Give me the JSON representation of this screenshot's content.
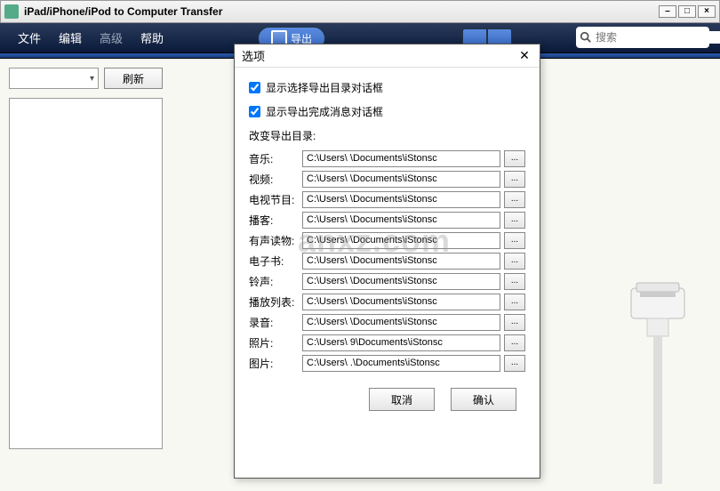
{
  "window": {
    "title": "iPad/iPhone/iPod to Computer Transfer"
  },
  "menu": {
    "file": "文件",
    "edit": "编辑",
    "advanced": "高级",
    "help": "帮助"
  },
  "toolbar": {
    "export": "导出"
  },
  "search": {
    "placeholder": "搜索"
  },
  "sidebar": {
    "refresh": "刷新"
  },
  "dialog": {
    "title": "选项",
    "check1": "显示选择导出目录对话框",
    "check2": "显示导出完成消息对话框",
    "section": "改变导出目录:",
    "rows": [
      {
        "label": "音乐:",
        "path": "C:\\Users\\          \\Documents\\iStonsc"
      },
      {
        "label": "视频:",
        "path": "C:\\Users\\          \\Documents\\iStonsc"
      },
      {
        "label": "电视节目:",
        "path": "C:\\Users\\          \\Documents\\iStonsc"
      },
      {
        "label": "播客:",
        "path": "C:\\Users\\          \\Documents\\iStonsc"
      },
      {
        "label": "有声读物:",
        "path": "C:\\Users\\          \\Documents\\iStonsc"
      },
      {
        "label": "电子书:",
        "path": "C:\\Users\\          \\Documents\\iStonsc"
      },
      {
        "label": "铃声:",
        "path": "C:\\Users\\          \\Documents\\iStonsc"
      },
      {
        "label": "播放列表:",
        "path": "C:\\Users\\          \\Documents\\iStonsc"
      },
      {
        "label": "录音:",
        "path": "C:\\Users\\          \\Documents\\iStonsc"
      },
      {
        "label": "照片:",
        "path": "C:\\Users\\        9\\Documents\\iStonsc"
      },
      {
        "label": "图片:",
        "path": "C:\\Users\\         .\\Documents\\iStonsc"
      }
    ],
    "browse": "...",
    "cancel": "取消",
    "ok": "确认"
  },
  "watermark": "anxz.com"
}
